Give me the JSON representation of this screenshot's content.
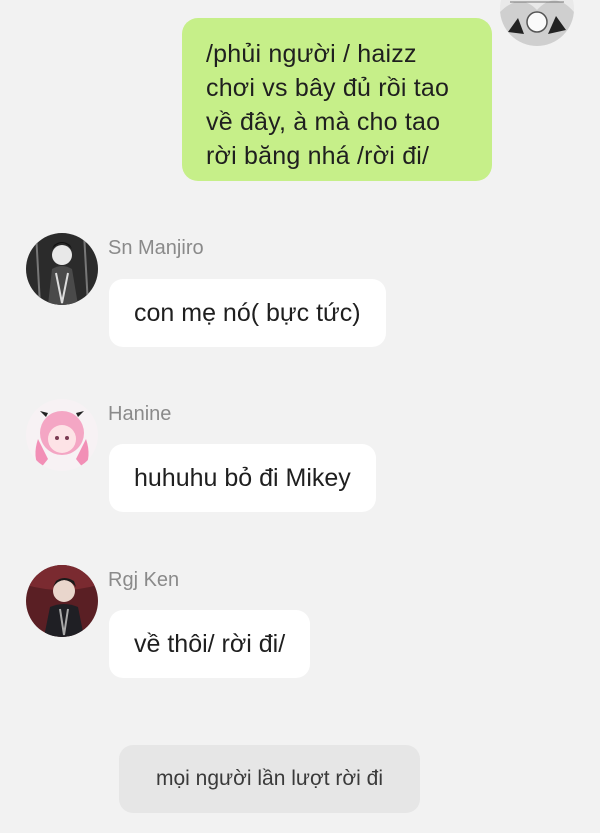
{
  "chat": {
    "outgoing": {
      "text": "/phủi người / haizz chơi vs bây đủ rồi tao về đây, à mà cho tao rời băng nhá /rời đi/"
    },
    "messages": [
      {
        "sender": "Sn Manjiro",
        "text": "con mẹ nó( bực tức)"
      },
      {
        "sender": "Hanine",
        "text": "huhuhu bỏ đi Mikey"
      },
      {
        "sender": "Rgj Ken",
        "text": "về thôi/ rời đi/"
      }
    ],
    "system_notice": "mọi người lần lượt rời đi"
  },
  "colors": {
    "background": "#f2f2f2",
    "outgoing_bubble": "#c6ef89",
    "incoming_bubble": "#ffffff",
    "notice_bubble": "#e6e6e6"
  },
  "icons": {
    "self_avatar": "self-avatar-icon",
    "manjiro_avatar": "manjiro-avatar-icon",
    "hanine_avatar": "hanine-avatar-icon",
    "ken_avatar": "ken-avatar-icon"
  }
}
